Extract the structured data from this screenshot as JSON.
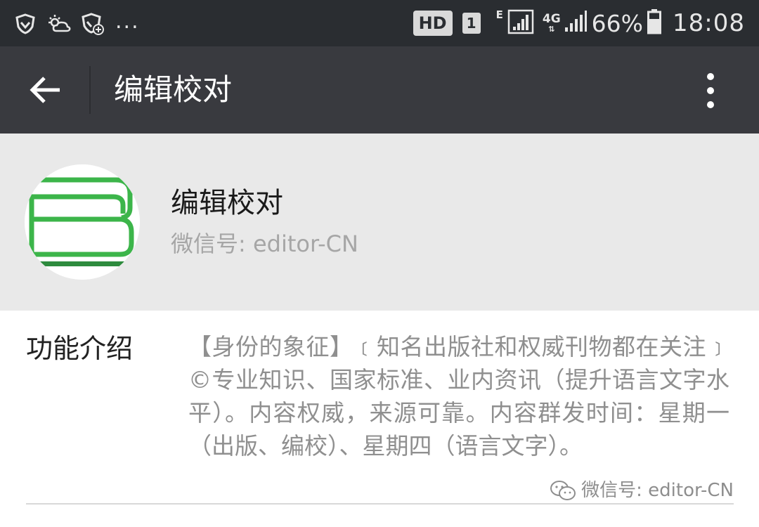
{
  "status_bar": {
    "left_icons": [
      "shield-icon",
      "weather-icon",
      "shield-add-icon"
    ],
    "overflow": "...",
    "hd_label": "HD",
    "sim_label": "1",
    "network_type_1": "E",
    "network_type_2": "4G",
    "battery_percent": "66%",
    "time": "18:08"
  },
  "app_bar": {
    "title": "编辑校对"
  },
  "profile": {
    "name": "编辑校对",
    "wechat_id": "微信号: editor-CN"
  },
  "intro": {
    "label": "功能介绍",
    "text": "【身份的象征】﹝知名出版社和权威刊物都在关注﹞©专业知识、国家标准、业内资讯（提升语言文字水平）。内容权威，来源可靠。内容群发时间：星期一（出版、编校）、星期四（语言文字）。"
  },
  "watermark": {
    "text": "微信号: editor-CN"
  },
  "colors": {
    "status_bar_bg": "#2a2d31",
    "app_bar_bg": "#393a3f",
    "header_bg": "#e9e9e9",
    "logo_green": "#3cb54a",
    "secondary_text": "#8f8f8f"
  }
}
